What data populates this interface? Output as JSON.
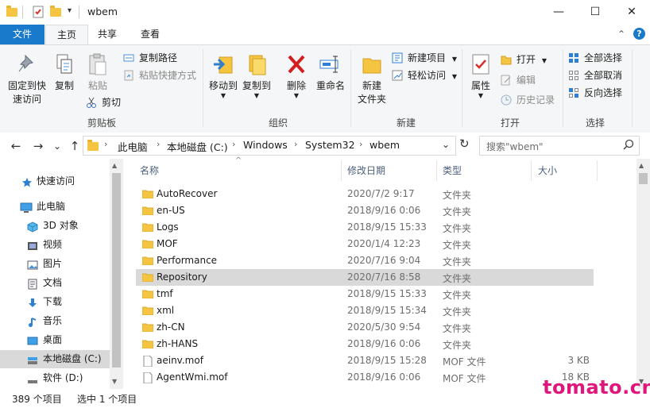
{
  "title_bar": {
    "title": "wbem",
    "minimize": "—",
    "maximize": "☐",
    "close": "✕",
    "qa_dropdown": "▾"
  },
  "ribbon_tabs": [
    {
      "label": "文件",
      "active_style": "file"
    },
    {
      "label": "主页",
      "active_style": "selected"
    },
    {
      "label": "共享",
      "active_style": "none"
    },
    {
      "label": "查看",
      "active_style": "none"
    }
  ],
  "ribbon_right": {
    "collapse": "⌃",
    "help": "?"
  },
  "ribbon": {
    "clipboard": {
      "pin_label_1": "固定到快",
      "pin_label_2": "速访问",
      "copy": "复制",
      "paste": "粘贴",
      "copy_path": "复制路径",
      "paste_shortcut": "粘贴快捷方式",
      "cut": "剪切",
      "group_label": "剪贴板"
    },
    "organize": {
      "move_to": "移动到",
      "copy_to": "复制到",
      "delete": "删除",
      "rename": "重命名",
      "group_label": "组织"
    },
    "new": {
      "new_folder_1": "新建",
      "new_folder_2": "文件夹",
      "new_item": "新建项目",
      "easy_access": "轻松访问",
      "group_label": "新建"
    },
    "open": {
      "properties": "属性",
      "open": "打开",
      "edit": "编辑",
      "history": "历史记录",
      "group_label": "打开"
    },
    "select": {
      "select_all": "全部选择",
      "select_none": "全部取消",
      "invert": "反向选择",
      "group_label": "选择"
    }
  },
  "address": {
    "back": "←",
    "forward": "→",
    "history": "⌄",
    "up": "↑",
    "crumbs": [
      "此电脑",
      "本地磁盘 (C:)",
      "Windows",
      "System32",
      "wbem"
    ],
    "crumb_sep": "›",
    "dropdown": "⌄",
    "refresh": "↻",
    "search_placeholder": "搜索\"wbem\""
  },
  "nav_pane": [
    {
      "label": "快速访问",
      "icon": "star-icon"
    },
    {
      "label": "此电脑",
      "icon": "computer-icon"
    },
    {
      "label": "3D 对象",
      "icon": "cube-icon"
    },
    {
      "label": "视频",
      "icon": "video-icon"
    },
    {
      "label": "图片",
      "icon": "picture-icon"
    },
    {
      "label": "文档",
      "icon": "document-icon"
    },
    {
      "label": "下载",
      "icon": "download-icon"
    },
    {
      "label": "音乐",
      "icon": "music-icon"
    },
    {
      "label": "桌面",
      "icon": "desktop-icon"
    },
    {
      "label": "本地磁盘 (C:)",
      "icon": "drive-icon"
    },
    {
      "label": "软件 (D:)",
      "icon": "drive-icon"
    }
  ],
  "columns": {
    "name": "名称",
    "date": "修改日期",
    "type": "类型",
    "size": "大小",
    "sort_arrow": "^"
  },
  "files": [
    {
      "name": "AutoRecover",
      "date": "2020/7/2 9:17",
      "type": "文件夹",
      "size": "",
      "kind": "folder"
    },
    {
      "name": "en-US",
      "date": "2018/9/16 0:06",
      "type": "文件夹",
      "size": "",
      "kind": "folder"
    },
    {
      "name": "Logs",
      "date": "2018/9/15 15:33",
      "type": "文件夹",
      "size": "",
      "kind": "folder"
    },
    {
      "name": "MOF",
      "date": "2020/1/4 12:23",
      "type": "文件夹",
      "size": "",
      "kind": "folder"
    },
    {
      "name": "Performance",
      "date": "2020/7/16 9:04",
      "type": "文件夹",
      "size": "",
      "kind": "folder"
    },
    {
      "name": "Repository",
      "date": "2020/7/16 8:58",
      "type": "文件夹",
      "size": "",
      "kind": "folder",
      "selected": true
    },
    {
      "name": "tmf",
      "date": "2018/9/15 15:33",
      "type": "文件夹",
      "size": "",
      "kind": "folder"
    },
    {
      "name": "xml",
      "date": "2018/9/15 15:34",
      "type": "文件夹",
      "size": "",
      "kind": "folder"
    },
    {
      "name": "zh-CN",
      "date": "2020/5/30 9:54",
      "type": "文件夹",
      "size": "",
      "kind": "folder"
    },
    {
      "name": "zh-HANS",
      "date": "2018/9/16 0:06",
      "type": "文件夹",
      "size": "",
      "kind": "folder"
    },
    {
      "name": "aeinv.mof",
      "date": "2018/9/15 15:28",
      "type": "MOF 文件",
      "size": "3 KB",
      "kind": "file"
    },
    {
      "name": "AgentWmi.mof",
      "date": "2018/9/16 0:06",
      "type": "MOF 文件",
      "size": "18 KB",
      "kind": "file"
    }
  ],
  "status": {
    "count": "389 个项目",
    "selected": "选中 1 个项目"
  },
  "watermark": "tomato.cn",
  "colors": {
    "accent": "#1979ca",
    "selection": "#d9d9d9",
    "folder": "#f5c542",
    "watermark": "#e0177a"
  }
}
